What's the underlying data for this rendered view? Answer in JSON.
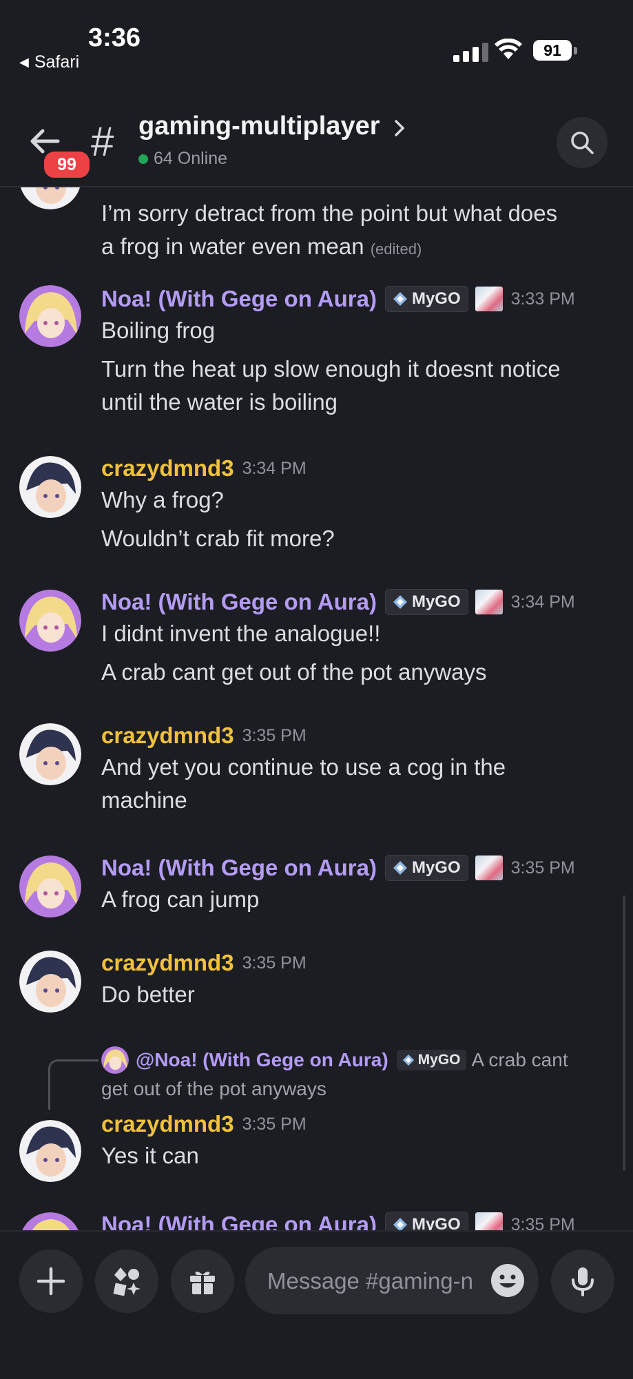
{
  "status": {
    "time": "3:36",
    "back_app": "Safari",
    "battery": "91"
  },
  "header": {
    "unread_badge": "99",
    "hash": "#",
    "channel_name": "gaming-multiplayer",
    "online": "64 Online"
  },
  "messages": [
    {
      "continuation": true,
      "lines": [
        "I’m sorry detract from the point but what does",
        "a frog in water even mean"
      ],
      "edited": "(edited)"
    },
    {
      "user": "Noa! (With Gege on Aura)",
      "tag": "MyGO",
      "time": "3:33 PM",
      "lines": [
        "Boiling frog"
      ],
      "lines2": [
        "Turn the heat up slow enough it doesnt notice",
        "until the water is boiling"
      ]
    },
    {
      "user": "crazydmnd3",
      "time": "3:34 PM",
      "lines": [
        "Why a frog?"
      ],
      "lines2": [
        "Wouldn’t crab fit more?"
      ]
    },
    {
      "user": "Noa! (With Gege on Aura)",
      "tag": "MyGO",
      "time": "3:34 PM",
      "lines": [
        "I didnt invent the analogue!!"
      ],
      "lines2": [
        "A crab cant get out of the pot anyways"
      ]
    },
    {
      "user": "crazydmnd3",
      "time": "3:35 PM",
      "lines": [
        "And yet you continue to use a cog in the",
        "machine"
      ]
    },
    {
      "user": "Noa! (With Gege on Aura)",
      "tag": "MyGO",
      "time": "3:35 PM",
      "lines": [
        "A frog can jump"
      ]
    },
    {
      "user": "crazydmnd3",
      "time": "3:35 PM",
      "lines": [
        "Do better"
      ]
    },
    {
      "reply": {
        "name": "@Noa! (With Gege on Aura)",
        "tag": "MyGO",
        "text_a": "A crab cant",
        "text_b": "get out of the pot anyways"
      },
      "user": "crazydmnd3",
      "time": "3:35 PM",
      "lines": [
        "Yes it can"
      ]
    },
    {
      "user": "Noa! (With Gege on Aura)",
      "tag": "MyGO",
      "time": "3:35 PM"
    }
  ],
  "composer": {
    "placeholder": "Message #gaming-n"
  },
  "colors": {
    "background": "#1c1d22",
    "noa_name": "#b49cf6",
    "crazy_name": "#f0c23b",
    "badge": "#ed4245",
    "online": "#23a55a"
  },
  "icons": [
    "back-arrow-icon",
    "chevron-right-icon",
    "search-icon",
    "plus-icon",
    "apps-icon",
    "gift-icon",
    "emoji-icon",
    "microphone-icon",
    "mygo-diamond-icon"
  ]
}
